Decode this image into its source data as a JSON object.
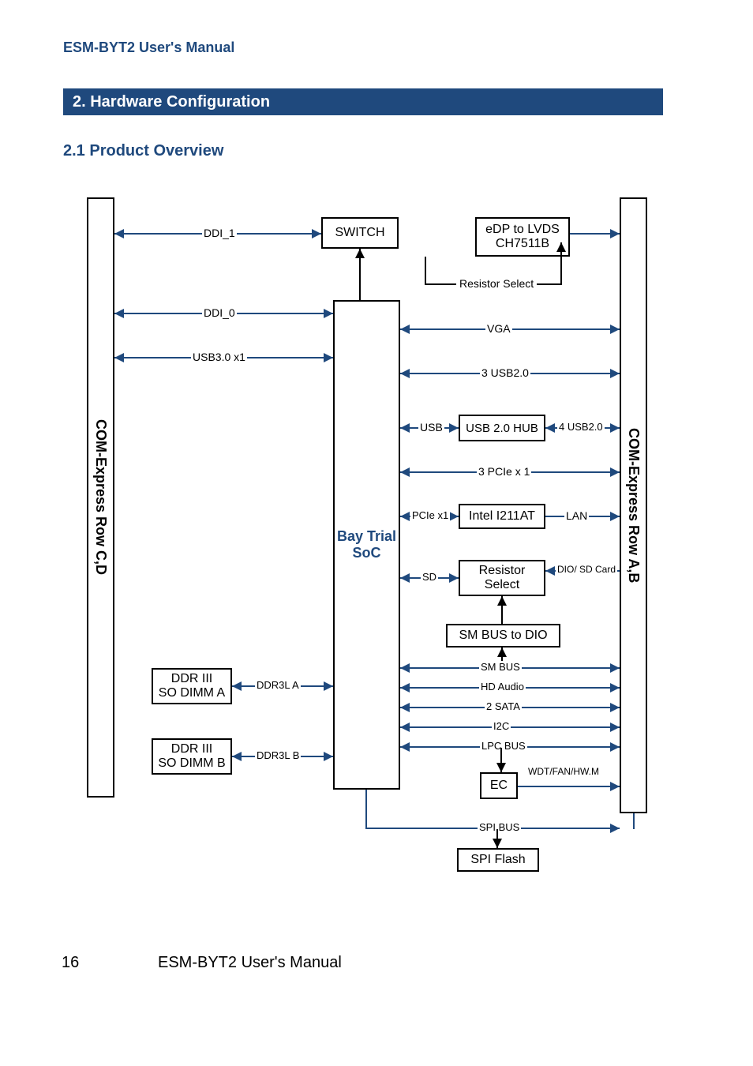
{
  "header_label": "ESM-BYT2 User's Manual",
  "chapter_bar": "2. Hardware Configuration",
  "sub_heading": "2.1 Product Overview",
  "footer": {
    "page": "16",
    "text": "ESM-BYT2 User's Manual"
  },
  "boxes": {
    "row_cd": "COM-Express Row C,D",
    "row_ab": "COM-Express Row A,B",
    "switch": "SWITCH",
    "lvds1": "eDP to LVDS",
    "lvds2": "CH7511B",
    "soc1": "Bay Trial",
    "soc2": "SoC",
    "hub": "USB 2.0 HUB",
    "i211": "Intel I211AT",
    "resistor1": "Resistor",
    "resistor2": "Select",
    "dio_sd": "DIO/ SD Card",
    "smbus_dio": "SM BUS to DIO",
    "ddr_a1": "DDR III",
    "ddr_a2": "SO DIMM A",
    "ddr_b1": "DDR III",
    "ddr_b2": "SO DIMM B",
    "ec": "EC",
    "spi_flash": "SPI Flash"
  },
  "labels": {
    "ddi1": "DDI_1",
    "ddi0": "DDI_0",
    "usb30": "USB3.0 x1",
    "resistor_sel": "Resistor Select",
    "vga": "VGA",
    "usb20_3": "3 USB2.0",
    "usb": "USB",
    "usb20_4": "4 USB2.0",
    "pcie3": "3 PCIe x 1",
    "pcie1": "PCIe x1",
    "lan": "LAN",
    "sd": "SD",
    "smbus": "SM BUS",
    "hdaudio": "HD Audio",
    "sata": "2 SATA",
    "i2c": "I2C",
    "lpc": "LPC BUS",
    "wdt": "WDT/FAN/HW.M",
    "spi": "SPI BUS",
    "ddr3la": "DDR3L A",
    "ddr3lb": "DDR3L B"
  }
}
